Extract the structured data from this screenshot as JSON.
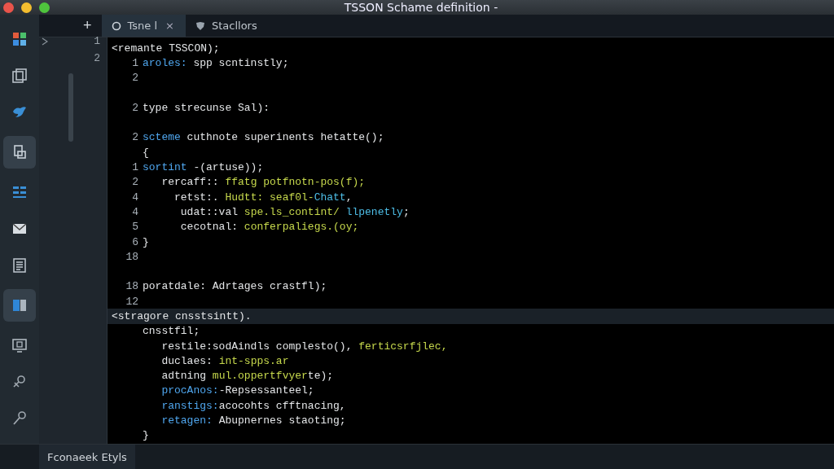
{
  "window": {
    "title": "TSSON Schame definition -"
  },
  "new_tab_button": "+",
  "tabs": [
    {
      "label": "Tsne l",
      "selected": true,
      "close": "×"
    },
    {
      "label": "Stacllors",
      "selected": false
    }
  ],
  "explorer": {
    "line_numbers": [
      "1",
      "2"
    ]
  },
  "editor": {
    "lines": [
      {
        "kind": "outdent",
        "segments": [
          {
            "text": "<remante TSSCON);",
            "kind": "plain"
          }
        ]
      },
      {
        "kind": "code",
        "num": "1",
        "segments": [
          {
            "text": "aroles:",
            "kind": "kw"
          },
          {
            "text": " spp scntinstly;",
            "kind": "plain"
          }
        ]
      },
      {
        "kind": "code",
        "num": "2"
      },
      {
        "kind": "blank"
      },
      {
        "kind": "code",
        "num": "2",
        "segments": [
          {
            "text": "type strecunse Sal):",
            "kind": "plain"
          }
        ]
      },
      {
        "kind": "blank"
      },
      {
        "kind": "code",
        "num": "2",
        "segments": [
          {
            "text": "scteme",
            "kind": "kw"
          },
          {
            "text": " cuthnote superinents hetatte();",
            "kind": "plain"
          }
        ]
      },
      {
        "kind": "code",
        "segments": [
          {
            "text": "{",
            "kind": "plain"
          }
        ]
      },
      {
        "kind": "code",
        "num": "1",
        "segments": [
          {
            "text": "sortint",
            "kind": "kw"
          },
          {
            "text": " -(artuse));",
            "kind": "plain"
          }
        ]
      },
      {
        "kind": "code",
        "num": "2",
        "segments": [
          {
            "text": "   rercaff:: ",
            "kind": "plain"
          },
          {
            "text": "ffatg potfnotn-pos(f);",
            "kind": "str"
          }
        ]
      },
      {
        "kind": "code",
        "num": "4",
        "segments": [
          {
            "text": "     retst:. ",
            "kind": "plain"
          },
          {
            "text": "Hudtt: seaf0l-",
            "kind": "str"
          },
          {
            "text": "Chatt",
            "kind": "fn"
          },
          {
            "text": ",",
            "kind": "plain"
          }
        ]
      },
      {
        "kind": "code",
        "num": "4",
        "segments": [
          {
            "text": "      udat::val ",
            "kind": "plain"
          },
          {
            "text": "spe.ls_contint/ ",
            "kind": "str"
          },
          {
            "text": "llpenetly",
            "kind": "fn"
          },
          {
            "text": ";",
            "kind": "plain"
          }
        ]
      },
      {
        "kind": "code",
        "num": "5",
        "segments": [
          {
            "text": "      cecotnal: ",
            "kind": "plain"
          },
          {
            "text": "conferpaliegs.(oy;",
            "kind": "str"
          }
        ]
      },
      {
        "kind": "code",
        "num": "6",
        "segments": [
          {
            "text": "}",
            "kind": "plain"
          }
        ]
      },
      {
        "kind": "code",
        "num": "18"
      },
      {
        "kind": "blank"
      },
      {
        "kind": "code",
        "num": "18",
        "segments": [
          {
            "text": "poratdale: Adrtages crastfl);",
            "kind": "plain"
          }
        ]
      },
      {
        "kind": "code",
        "num": "12"
      },
      {
        "kind": "outdent",
        "current": true,
        "segments": [
          {
            "text": "<stragore cnsstsintt).",
            "kind": "plain"
          }
        ]
      },
      {
        "kind": "code",
        "segments": [
          {
            "text": "cnsstfil;",
            "kind": "plain"
          }
        ]
      },
      {
        "kind": "code",
        "segments": [
          {
            "text": "   restile:sodAindls complesto(), ",
            "kind": "plain"
          },
          {
            "text": "ferticsrfjlec,",
            "kind": "str"
          }
        ]
      },
      {
        "kind": "code",
        "segments": [
          {
            "text": "   duclaes: ",
            "kind": "plain"
          },
          {
            "text": "int-spps.ar",
            "kind": "str"
          }
        ]
      },
      {
        "kind": "code",
        "segments": [
          {
            "text": "   adtning ",
            "kind": "plain"
          },
          {
            "text": "mul.oppertfvyer",
            "kind": "str"
          },
          {
            "text": "te);",
            "kind": "plain"
          }
        ]
      },
      {
        "kind": "code",
        "segments": [
          {
            "text": "   procAnos:",
            "kind": "kw"
          },
          {
            "text": "-Repsessanteel;",
            "kind": "plain"
          }
        ]
      },
      {
        "kind": "code",
        "segments": [
          {
            "text": "   ranstigs:",
            "kind": "kw"
          },
          {
            "text": "acocohts cfftnacing,",
            "kind": "plain"
          }
        ]
      },
      {
        "kind": "code",
        "segments": [
          {
            "text": "   retagen:",
            "kind": "kw"
          },
          {
            "text": " Abupnernes staoting;",
            "kind": "plain"
          }
        ]
      },
      {
        "kind": "code",
        "segments": [
          {
            "text": "}",
            "kind": "plain"
          }
        ]
      }
    ]
  },
  "bottom_panel": {
    "label": "Fconaeek Etyls"
  }
}
